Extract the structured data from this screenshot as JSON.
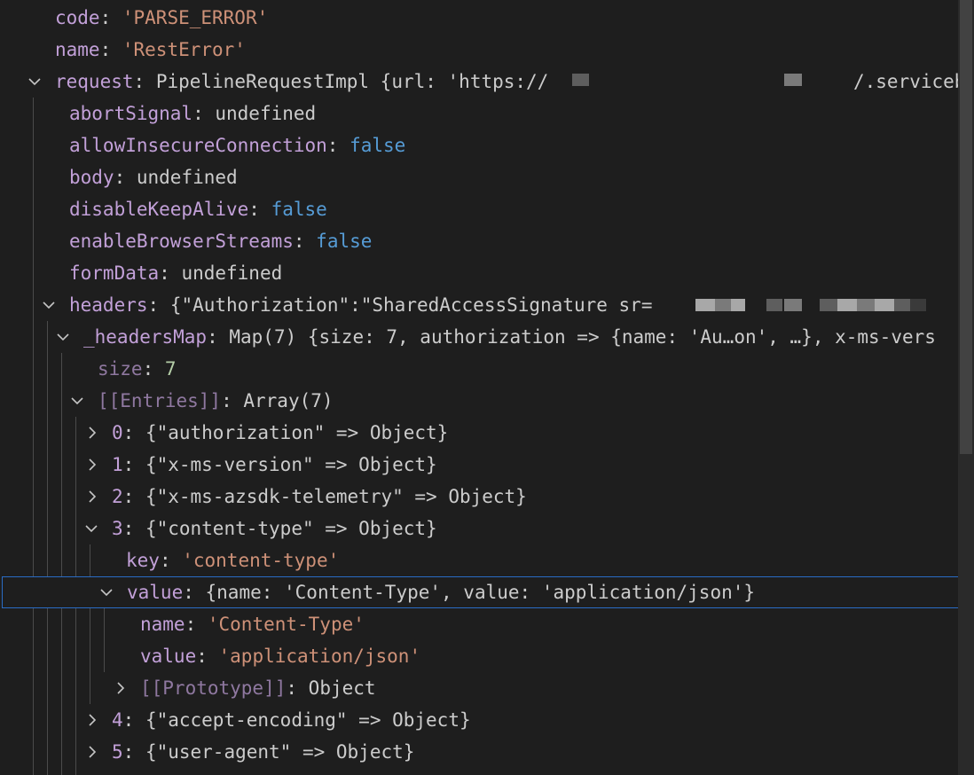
{
  "rows": {
    "code": {
      "key": "code",
      "sep": ": ",
      "value": "'PARSE_ERROR'"
    },
    "name": {
      "key": "name",
      "sep": ": ",
      "value": "'RestError'"
    },
    "request": {
      "key": "request",
      "sep": ": ",
      "value_a": "PipelineRequestImpl {url: 'https://",
      "value_b": "/.servicebu"
    },
    "abortSignal": {
      "key": "abortSignal",
      "sep": ": ",
      "value": "undefined"
    },
    "allowInsecureConnection": {
      "key": "allowInsecureConnection",
      "sep": ": ",
      "value": "false"
    },
    "body": {
      "key": "body",
      "sep": ": ",
      "value": "undefined"
    },
    "disableKeepAlive": {
      "key": "disableKeepAlive",
      "sep": ": ",
      "value": "false"
    },
    "enableBrowserStreams": {
      "key": "enableBrowserStreams",
      "sep": ": ",
      "value": "false"
    },
    "formData": {
      "key": "formData",
      "sep": ": ",
      "value": "undefined"
    },
    "headers": {
      "key": "headers",
      "sep": ": ",
      "value": "{\"Authorization\":\"SharedAccessSignature sr="
    },
    "headersMap": {
      "key": "_headersMap",
      "sep": ": ",
      "value": "Map(7) {size: 7, authorization => {name: 'Au…on', …}, x-ms-vers"
    },
    "size": {
      "key": "size",
      "sep": ": ",
      "value": "7"
    },
    "entries": {
      "key": "[[Entries]]",
      "sep": ": ",
      "value": "Array(7)"
    },
    "e0": {
      "key": "0",
      "sep": ": ",
      "value": "{\"authorization\" => Object}"
    },
    "e1": {
      "key": "1",
      "sep": ": ",
      "value": "{\"x-ms-version\" => Object}"
    },
    "e2": {
      "key": "2",
      "sep": ": ",
      "value": "{\"x-ms-azsdk-telemetry\" => Object}"
    },
    "e3": {
      "key": "3",
      "sep": ": ",
      "value": "{\"content-type\" => Object}"
    },
    "e3key": {
      "key": "key",
      "sep": ": ",
      "value": "'content-type'"
    },
    "e3value": {
      "key": "value",
      "sep": ": ",
      "value": "{name: 'Content-Type', value: 'application/json'}"
    },
    "e3vname": {
      "key": "name",
      "sep": ": ",
      "value": "'Content-Type'"
    },
    "e3vvalue": {
      "key": "value",
      "sep": ": ",
      "value": "'application/json'"
    },
    "e3vproto": {
      "key": "[[Prototype]]",
      "sep": ": ",
      "value": "Object"
    },
    "e4": {
      "key": "4",
      "sep": ": ",
      "value": "{\"accept-encoding\" => Object}"
    },
    "e5": {
      "key": "5",
      "sep": ": ",
      "value": "{\"user-agent\" => Object}"
    }
  },
  "colors": {
    "background": "#1e1e1e",
    "key": "#c2a0d8",
    "string": "#ce9178",
    "boolean": "#569cd6",
    "number": "#b5cea8",
    "selection_border": "#2a6cc5"
  },
  "icons": {
    "expanded": "chevron-down-icon",
    "collapsed": "chevron-right-icon"
  }
}
